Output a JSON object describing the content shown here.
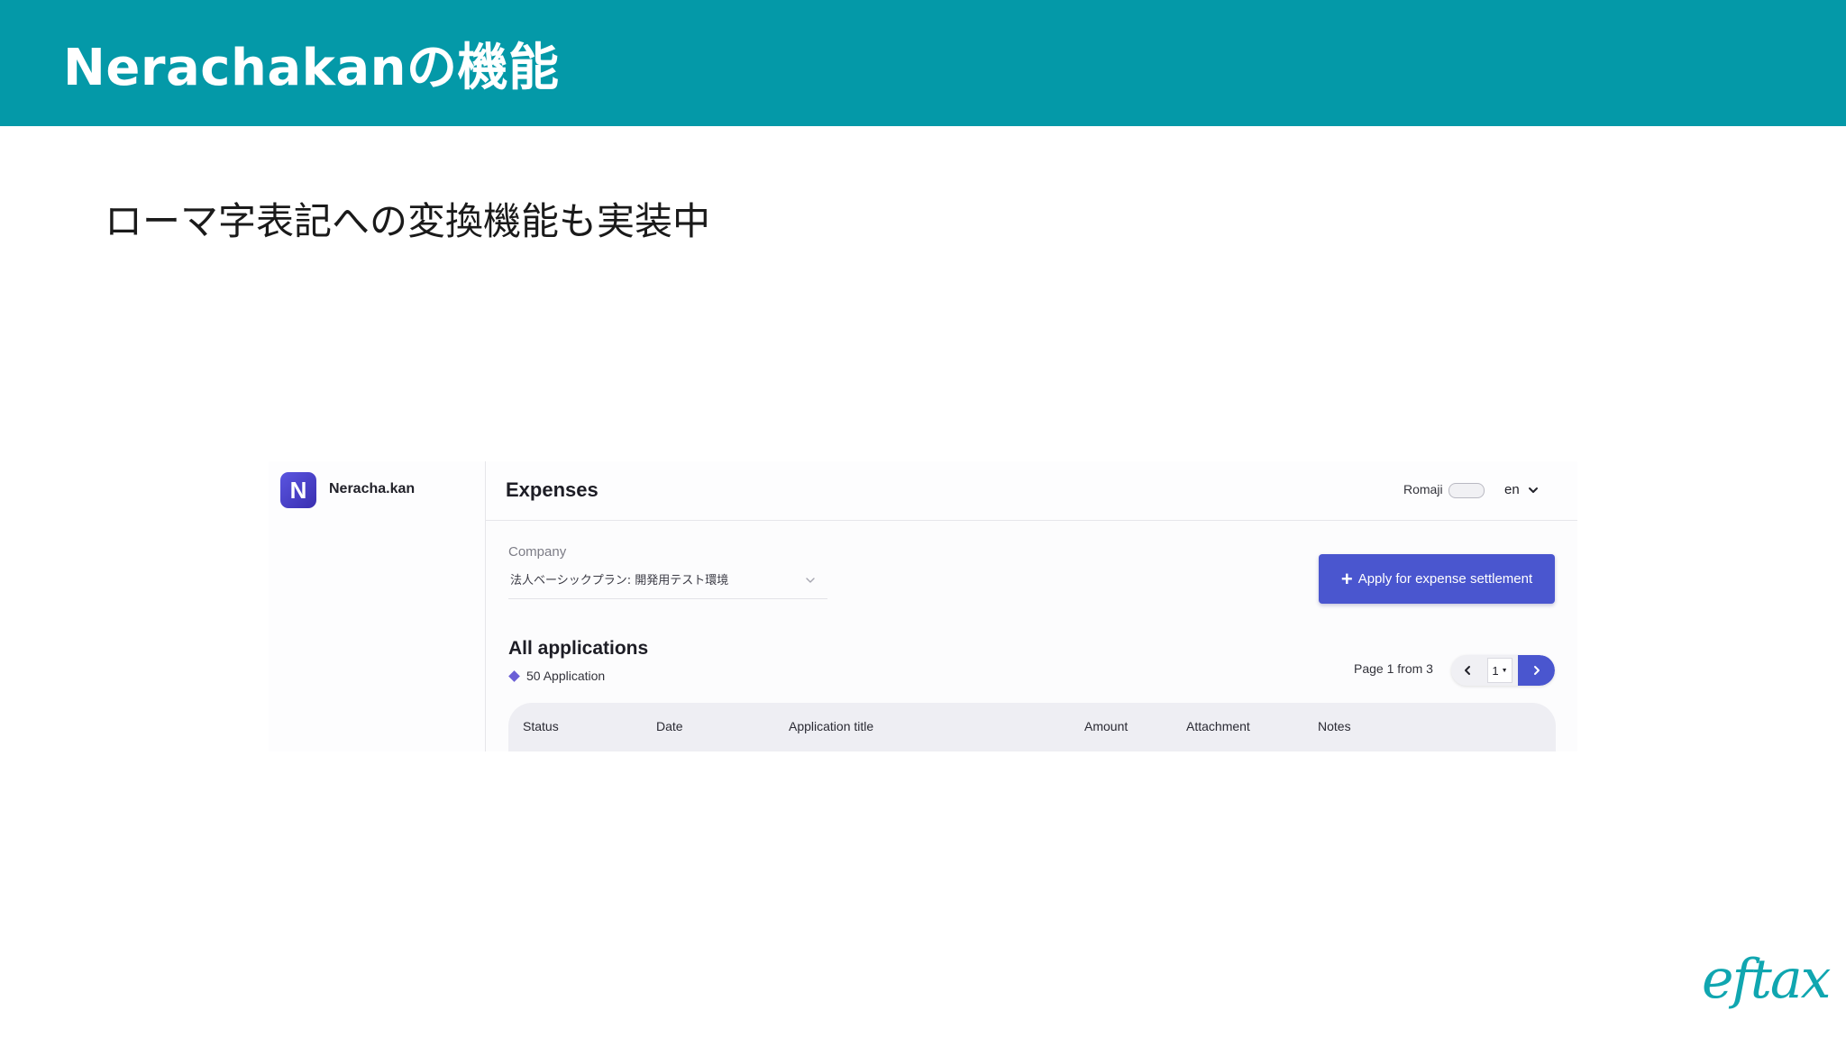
{
  "slide": {
    "title": "Nerachakanの機能",
    "subtitle": "ローマ字表記への変換機能も実装中",
    "brand_logo": "eftax"
  },
  "app": {
    "logo_letter": "N",
    "name": "Neracha.kan",
    "page_heading": "Expenses",
    "romaji_label": "Romaji",
    "language": "en",
    "company": {
      "label": "Company",
      "value": "法人ベーシックプラン: 開発用テスト環境"
    },
    "apply_button": "Apply for expense settlement",
    "section_title": "All applications",
    "count_text": "50 Application",
    "pagination": {
      "info": "Page 1 from 3",
      "current": "1"
    },
    "table_headers": [
      "Status",
      "Date",
      "Application title",
      "Amount",
      "Attachment",
      "Notes"
    ]
  },
  "colors": {
    "header_teal": "#0499a8",
    "accent_indigo": "#4a56cf",
    "brand_teal": "#10a6b0"
  }
}
